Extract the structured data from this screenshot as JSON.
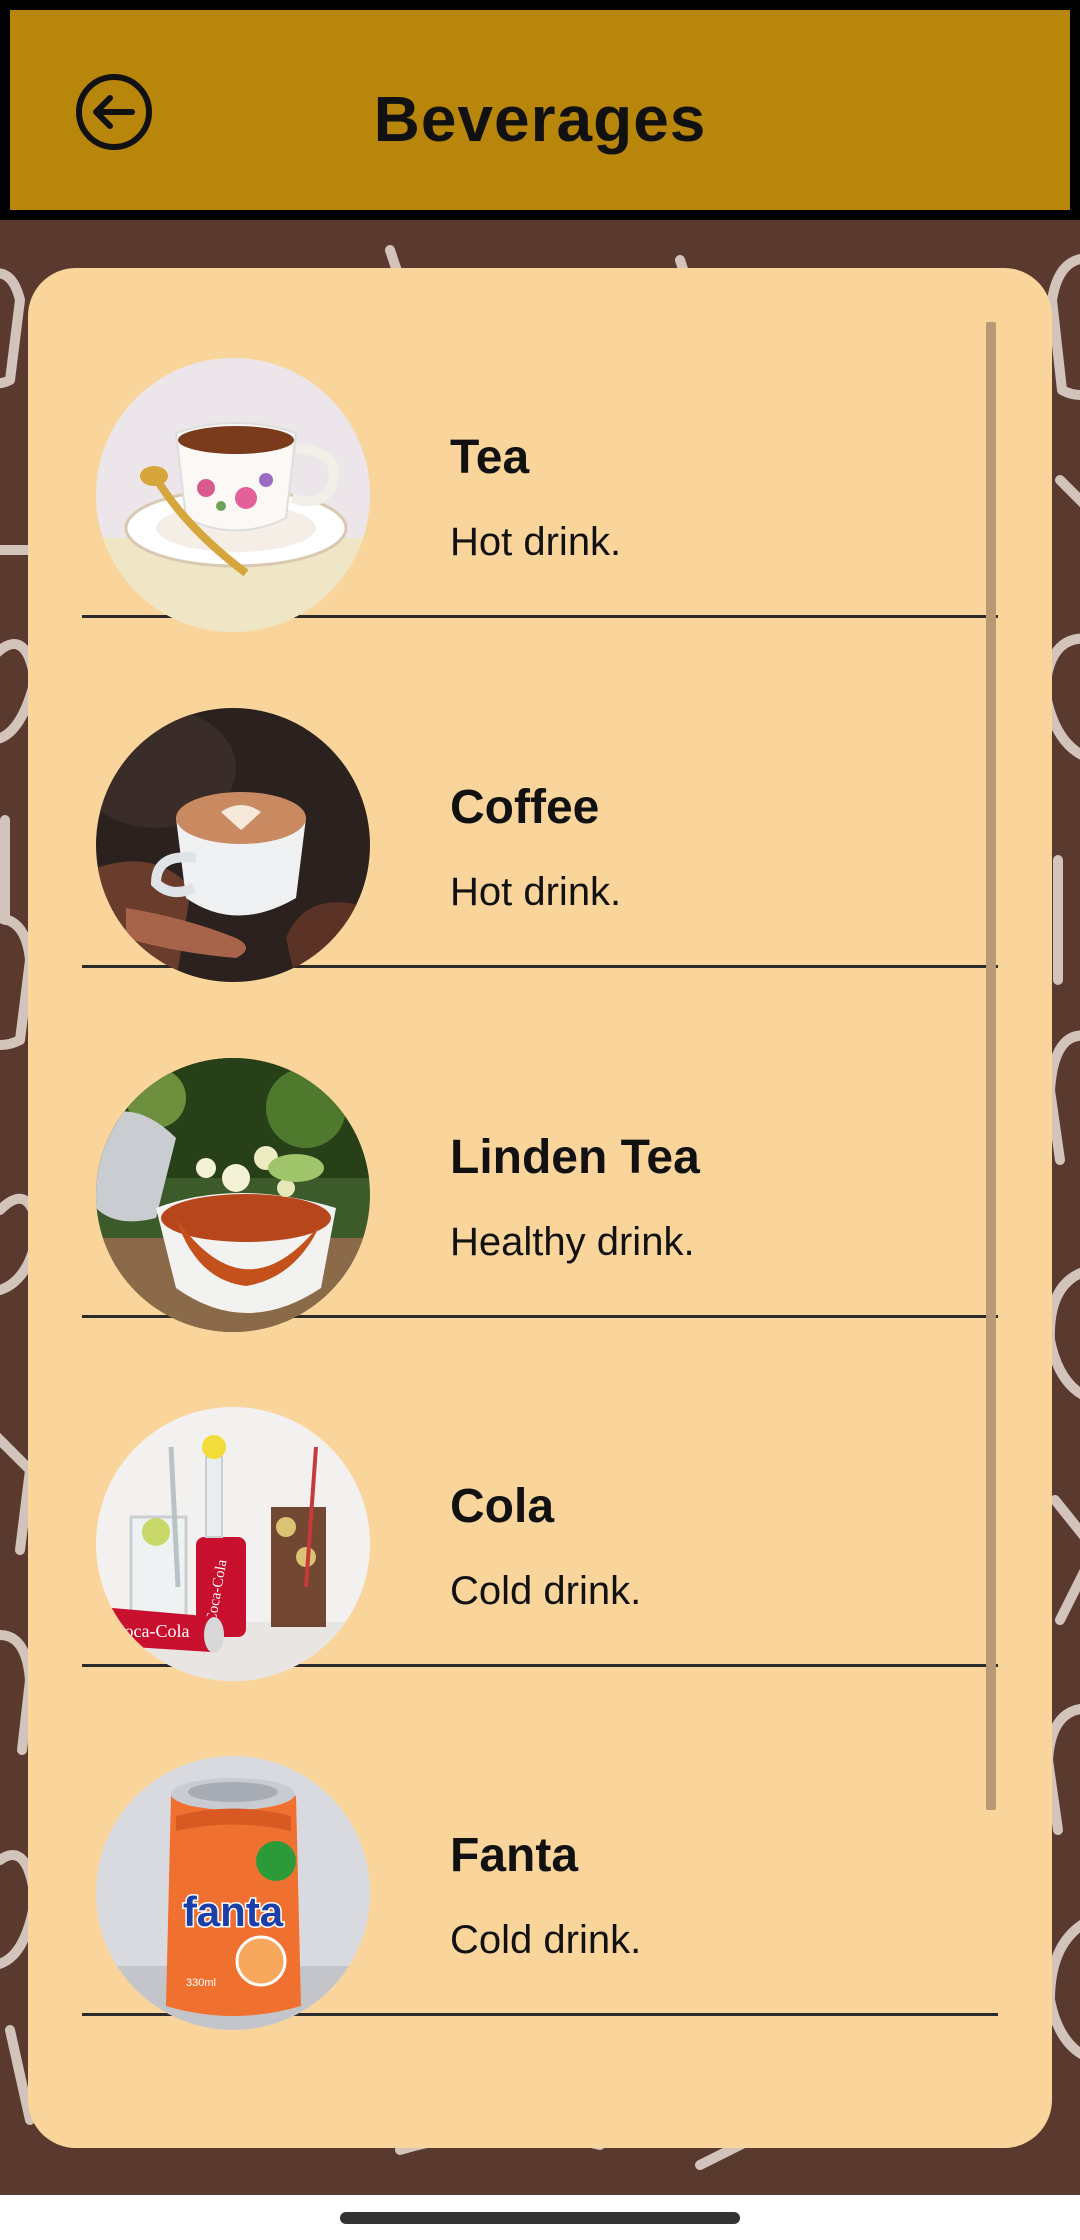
{
  "header": {
    "title": "Beverages",
    "back_icon": "arrow-left-circle-icon"
  },
  "colors": {
    "header_bg": "#b8860b",
    "page_bg": "#5a3a2e",
    "card_bg": "#f9d59c",
    "text": "#111111"
  },
  "beverages": [
    {
      "name": "Tea",
      "description": "Hot drink.",
      "image": "tea-cup-image"
    },
    {
      "name": "Coffee",
      "description": "Hot drink.",
      "image": "coffee-latte-image"
    },
    {
      "name": "Linden Tea",
      "description": "Healthy drink.",
      "image": "linden-tea-image"
    },
    {
      "name": "Cola",
      "description": "Cold drink.",
      "image": "cola-glasses-image"
    },
    {
      "name": "Fanta",
      "description": "Cold drink.",
      "image": "fanta-can-image"
    }
  ]
}
